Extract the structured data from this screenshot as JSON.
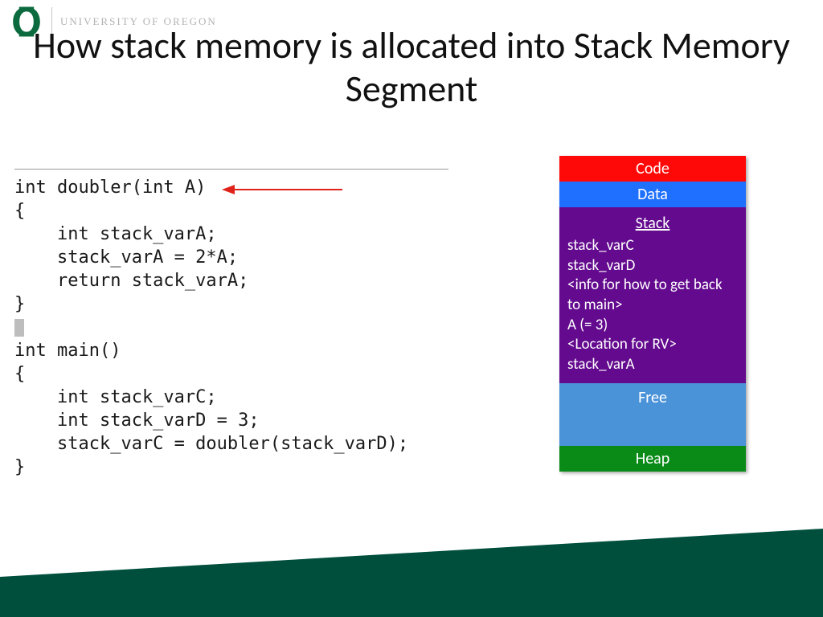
{
  "header": {
    "institution": "UNIVERSITY OF OREGON"
  },
  "title": "How stack memory is allocated into Stack Memory Segment",
  "code": {
    "line1": "int doubler(int A)",
    "line2": "{",
    "line3": "    int stack_varA;",
    "line4": "    stack_varA = 2*A;",
    "line5": "    return stack_varA;",
    "line6": "}",
    "line7_blank": "",
    "line8": "int main()",
    "line9": "{",
    "line10": "    int stack_varC;",
    "line11": "    int stack_varD = 3;",
    "line12": "    stack_varC = doubler(stack_varD);",
    "line13": "}"
  },
  "memory": {
    "code_label": "Code",
    "data_label": "Data",
    "stack_label": "Stack",
    "stack_items": {
      "i0": "stack_varC",
      "i1": "stack_varD",
      "i2": "<info for how to get back to main>",
      "i3": "A (= 3)",
      "i4": "<Location for RV>",
      "i5": "stack_varA"
    },
    "free_label": "Free",
    "heap_label": "Heap"
  },
  "colors": {
    "code_bg": "#ff0808",
    "data_bg": "#1f70ff",
    "stack_bg": "#630a8e",
    "free_bg": "#4b93d9",
    "heap_bg": "#0a8b18",
    "footer": "#004f3d",
    "logo": "#0b6a3e",
    "arrow": "#e0231a"
  }
}
